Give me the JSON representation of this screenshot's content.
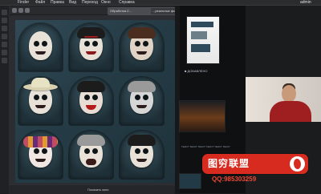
{
  "menubar": {
    "apple": "",
    "items": [
      "Finder",
      "Файл",
      "Правка",
      "Вид",
      "Переход",
      "Окно",
      "Справка"
    ],
    "status": "admin"
  },
  "toolbar": {
    "tab_active": "Обработка 2...",
    "tab_2": "...реальные фото"
  },
  "sidepanel": {
    "caption": "■ ДОБАВЛЕНО",
    "caption2": "",
    "caption3": "ТЕКСТ ТЕКСТ ТЕКСТ ТЕКСТ ТЕКСТ ТЕКСТ"
  },
  "canvas": {
    "bottom_label": "Показать окно"
  },
  "watermark": {
    "title": "图穷联盟",
    "qq": "QQ:985303259",
    "brand_color": "#d82b20"
  },
  "colors": {
    "background": "#1b1c1e",
    "wall": "#2a4450",
    "accent_red": "#d82b20"
  }
}
